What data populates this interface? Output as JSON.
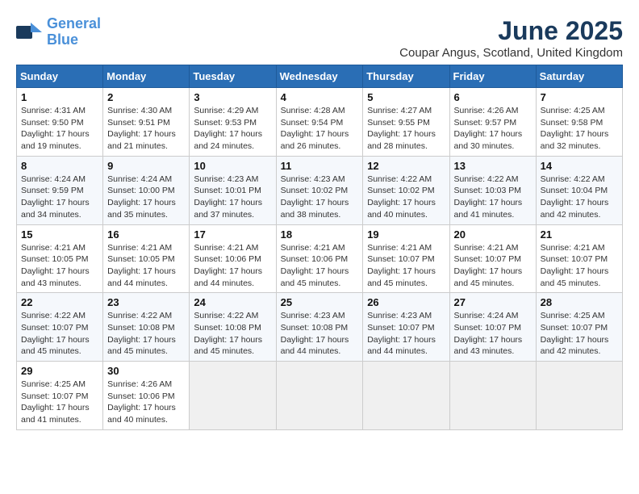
{
  "logo": {
    "line1": "General",
    "line2": "Blue"
  },
  "title": "June 2025",
  "location": "Coupar Angus, Scotland, United Kingdom",
  "weekdays": [
    "Sunday",
    "Monday",
    "Tuesday",
    "Wednesday",
    "Thursday",
    "Friday",
    "Saturday"
  ],
  "weeks": [
    [
      {
        "day": "1",
        "info": "Sunrise: 4:31 AM\nSunset: 9:50 PM\nDaylight: 17 hours\nand 19 minutes."
      },
      {
        "day": "2",
        "info": "Sunrise: 4:30 AM\nSunset: 9:51 PM\nDaylight: 17 hours\nand 21 minutes."
      },
      {
        "day": "3",
        "info": "Sunrise: 4:29 AM\nSunset: 9:53 PM\nDaylight: 17 hours\nand 24 minutes."
      },
      {
        "day": "4",
        "info": "Sunrise: 4:28 AM\nSunset: 9:54 PM\nDaylight: 17 hours\nand 26 minutes."
      },
      {
        "day": "5",
        "info": "Sunrise: 4:27 AM\nSunset: 9:55 PM\nDaylight: 17 hours\nand 28 minutes."
      },
      {
        "day": "6",
        "info": "Sunrise: 4:26 AM\nSunset: 9:57 PM\nDaylight: 17 hours\nand 30 minutes."
      },
      {
        "day": "7",
        "info": "Sunrise: 4:25 AM\nSunset: 9:58 PM\nDaylight: 17 hours\nand 32 minutes."
      }
    ],
    [
      {
        "day": "8",
        "info": "Sunrise: 4:24 AM\nSunset: 9:59 PM\nDaylight: 17 hours\nand 34 minutes."
      },
      {
        "day": "9",
        "info": "Sunrise: 4:24 AM\nSunset: 10:00 PM\nDaylight: 17 hours\nand 35 minutes."
      },
      {
        "day": "10",
        "info": "Sunrise: 4:23 AM\nSunset: 10:01 PM\nDaylight: 17 hours\nand 37 minutes."
      },
      {
        "day": "11",
        "info": "Sunrise: 4:23 AM\nSunset: 10:02 PM\nDaylight: 17 hours\nand 38 minutes."
      },
      {
        "day": "12",
        "info": "Sunrise: 4:22 AM\nSunset: 10:02 PM\nDaylight: 17 hours\nand 40 minutes."
      },
      {
        "day": "13",
        "info": "Sunrise: 4:22 AM\nSunset: 10:03 PM\nDaylight: 17 hours\nand 41 minutes."
      },
      {
        "day": "14",
        "info": "Sunrise: 4:22 AM\nSunset: 10:04 PM\nDaylight: 17 hours\nand 42 minutes."
      }
    ],
    [
      {
        "day": "15",
        "info": "Sunrise: 4:21 AM\nSunset: 10:05 PM\nDaylight: 17 hours\nand 43 minutes."
      },
      {
        "day": "16",
        "info": "Sunrise: 4:21 AM\nSunset: 10:05 PM\nDaylight: 17 hours\nand 44 minutes."
      },
      {
        "day": "17",
        "info": "Sunrise: 4:21 AM\nSunset: 10:06 PM\nDaylight: 17 hours\nand 44 minutes."
      },
      {
        "day": "18",
        "info": "Sunrise: 4:21 AM\nSunset: 10:06 PM\nDaylight: 17 hours\nand 45 minutes."
      },
      {
        "day": "19",
        "info": "Sunrise: 4:21 AM\nSunset: 10:07 PM\nDaylight: 17 hours\nand 45 minutes."
      },
      {
        "day": "20",
        "info": "Sunrise: 4:21 AM\nSunset: 10:07 PM\nDaylight: 17 hours\nand 45 minutes."
      },
      {
        "day": "21",
        "info": "Sunrise: 4:21 AM\nSunset: 10:07 PM\nDaylight: 17 hours\nand 45 minutes."
      }
    ],
    [
      {
        "day": "22",
        "info": "Sunrise: 4:22 AM\nSunset: 10:07 PM\nDaylight: 17 hours\nand 45 minutes."
      },
      {
        "day": "23",
        "info": "Sunrise: 4:22 AM\nSunset: 10:08 PM\nDaylight: 17 hours\nand 45 minutes."
      },
      {
        "day": "24",
        "info": "Sunrise: 4:22 AM\nSunset: 10:08 PM\nDaylight: 17 hours\nand 45 minutes."
      },
      {
        "day": "25",
        "info": "Sunrise: 4:23 AM\nSunset: 10:08 PM\nDaylight: 17 hours\nand 44 minutes."
      },
      {
        "day": "26",
        "info": "Sunrise: 4:23 AM\nSunset: 10:07 PM\nDaylight: 17 hours\nand 44 minutes."
      },
      {
        "day": "27",
        "info": "Sunrise: 4:24 AM\nSunset: 10:07 PM\nDaylight: 17 hours\nand 43 minutes."
      },
      {
        "day": "28",
        "info": "Sunrise: 4:25 AM\nSunset: 10:07 PM\nDaylight: 17 hours\nand 42 minutes."
      }
    ],
    [
      {
        "day": "29",
        "info": "Sunrise: 4:25 AM\nSunset: 10:07 PM\nDaylight: 17 hours\nand 41 minutes."
      },
      {
        "day": "30",
        "info": "Sunrise: 4:26 AM\nSunset: 10:06 PM\nDaylight: 17 hours\nand 40 minutes."
      },
      {
        "day": "",
        "info": ""
      },
      {
        "day": "",
        "info": ""
      },
      {
        "day": "",
        "info": ""
      },
      {
        "day": "",
        "info": ""
      },
      {
        "day": "",
        "info": ""
      }
    ]
  ]
}
